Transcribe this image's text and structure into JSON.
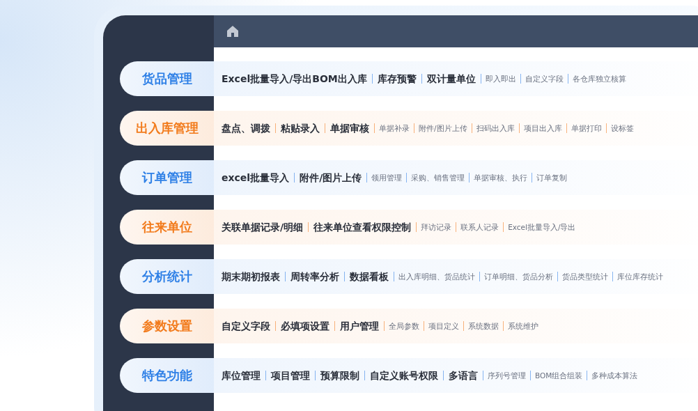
{
  "categories": [
    {
      "name": "货品管理",
      "color": "#2f80e6",
      "items": [
        {
          "text": "Excel批量导入/导出BOM出入库",
          "kind": "major"
        },
        {
          "text": "库存预警",
          "kind": "major"
        },
        {
          "text": "双计量单位",
          "kind": "major"
        },
        {
          "text": "即入即出",
          "kind": "minor"
        },
        {
          "text": "自定义字段",
          "kind": "minor"
        },
        {
          "text": "各仓库独立核算",
          "kind": "minor"
        }
      ]
    },
    {
      "name": "出入库管理",
      "color": "#f27b1c",
      "items": [
        {
          "text": "盘点、调拨",
          "kind": "major"
        },
        {
          "text": "粘贴录入",
          "kind": "major"
        },
        {
          "text": "单据审核",
          "kind": "major"
        },
        {
          "text": "单据补录",
          "kind": "minor"
        },
        {
          "text": "附件/图片上传",
          "kind": "minor"
        },
        {
          "text": "扫码出入库",
          "kind": "minor"
        },
        {
          "text": "项目出入库",
          "kind": "minor"
        },
        {
          "text": "单据打印",
          "kind": "minor"
        },
        {
          "text": "设标签",
          "kind": "minor"
        }
      ]
    },
    {
      "name": "订单管理",
      "color": "#2f80e6",
      "items": [
        {
          "text": "excel批量导入",
          "kind": "major"
        },
        {
          "text": "附件/图片上传",
          "kind": "major"
        },
        {
          "text": "领用管理",
          "kind": "minor"
        },
        {
          "text": "采购、销售管理",
          "kind": "minor"
        },
        {
          "text": "单据审核、执行",
          "kind": "minor"
        },
        {
          "text": "订单复制",
          "kind": "minor"
        }
      ]
    },
    {
      "name": "往来单位",
      "color": "#f27b1c",
      "items": [
        {
          "text": "关联单据记录/明细",
          "kind": "major"
        },
        {
          "text": "往来单位查看权限控制",
          "kind": "major"
        },
        {
          "text": "拜访记录",
          "kind": "minor"
        },
        {
          "text": "联系人记录",
          "kind": "minor"
        },
        {
          "text": "Excel批量导入/导出",
          "kind": "minor"
        }
      ]
    },
    {
      "name": "分析统计",
      "color": "#2f80e6",
      "items": [
        {
          "text": "期末期初报表",
          "kind": "major"
        },
        {
          "text": "周转率分析",
          "kind": "major"
        },
        {
          "text": "数据看板",
          "kind": "major"
        },
        {
          "text": "出入库明细、货品统计",
          "kind": "minor"
        },
        {
          "text": "订单明细、货品分析",
          "kind": "minor"
        },
        {
          "text": "货品类型统计",
          "kind": "minor"
        },
        {
          "text": "库位库存统计",
          "kind": "minor"
        }
      ]
    },
    {
      "name": "参数设置",
      "color": "#f27b1c",
      "items": [
        {
          "text": "自定义字段",
          "kind": "major"
        },
        {
          "text": "必填项设置",
          "kind": "major"
        },
        {
          "text": "用户管理",
          "kind": "major"
        },
        {
          "text": "全局参数",
          "kind": "minor"
        },
        {
          "text": "项目定义",
          "kind": "minor"
        },
        {
          "text": "系统数据",
          "kind": "minor"
        },
        {
          "text": "系统维护",
          "kind": "minor"
        }
      ]
    },
    {
      "name": "特色功能",
      "color": "#2f80e6",
      "items": [
        {
          "text": "库位管理",
          "kind": "major"
        },
        {
          "text": "项目管理",
          "kind": "major"
        },
        {
          "text": "预算限制",
          "kind": "major"
        },
        {
          "text": "自定义账号权限",
          "kind": "major"
        },
        {
          "text": "多语言",
          "kind": "major"
        },
        {
          "text": "序列号管理",
          "kind": "minor"
        },
        {
          "text": "BOM组合组装",
          "kind": "minor"
        },
        {
          "text": "多种成本算法",
          "kind": "minor"
        }
      ]
    }
  ]
}
